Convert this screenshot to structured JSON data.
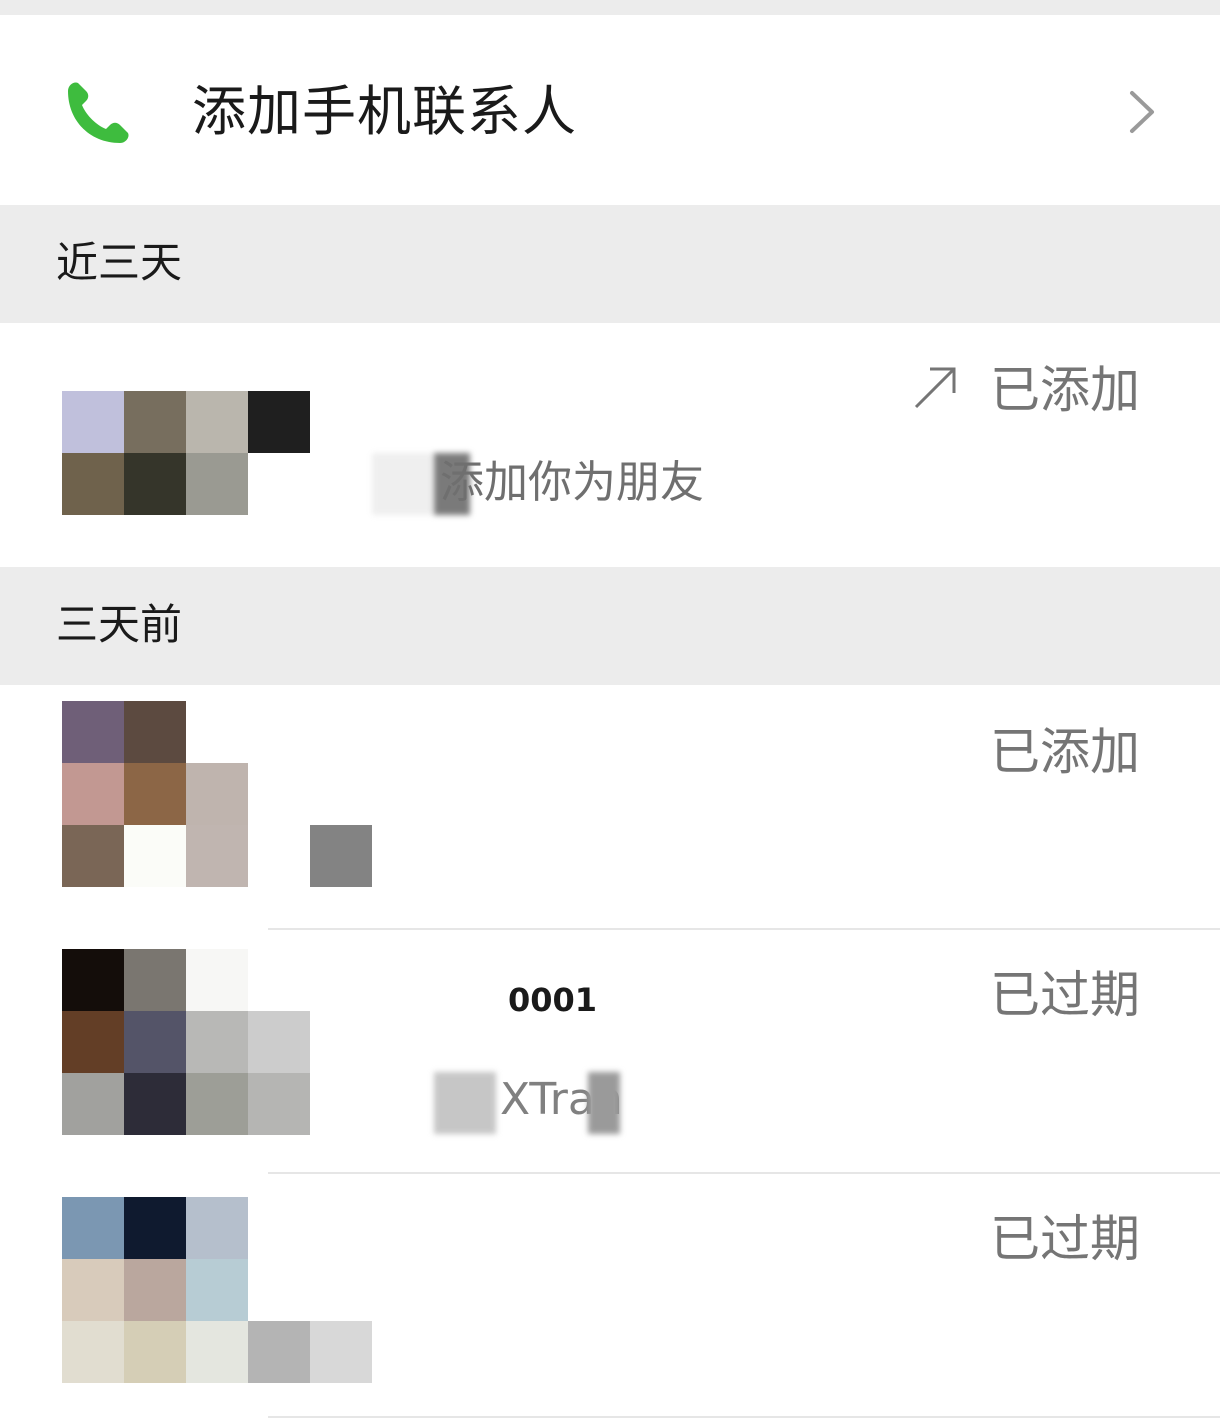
{
  "add_contacts": {
    "label": "添加手机联系人",
    "icon": "phone-icon",
    "accent": "#3ebc3e"
  },
  "sections": [
    {
      "label": "近三天"
    },
    {
      "label": "三天前"
    }
  ],
  "rows": [
    {
      "status": "已添加",
      "status_icon": "arrow-up-right-icon",
      "message": "添加你为朋友",
      "avatar_cells": [
        "#c0c0dc",
        "#776e5e",
        "#bab6ad",
        "#1f1f1f",
        "",
        "#6f624c",
        "#35352a",
        "#9a9a92",
        "",
        ""
      ]
    },
    {
      "status": "已添加",
      "avatar_cells": [
        "#6f5f78",
        "#5c4a40",
        "",
        "",
        "",
        "#c29892",
        "#8c6646",
        "#bfb4ae",
        "",
        "",
        "#7a6656",
        "#fbfcf8",
        "#c0b5b0",
        "",
        "#838383"
      ]
    },
    {
      "status": "已过期",
      "name": "0001",
      "message": "XTran",
      "avatar_cells": [
        "#140d0a",
        "#7a7670",
        "#f7f7f5",
        "",
        "",
        "#633e26",
        "#545468",
        "#b8b8b6",
        "#cccccc",
        "",
        "#a1a19e",
        "#2d2c38",
        "#9d9e97",
        "#b5b5b3",
        ""
      ]
    },
    {
      "status": "已过期",
      "avatar_cells": [
        "#7b97b2",
        "#0f1a2f",
        "#b5bfcc",
        "",
        "",
        "#d8cbbb",
        "#baa79e",
        "#b7ccd4",
        "",
        "",
        "#e1ddd0",
        "#d5ceb6",
        "#e4e6df",
        "#b4b4b4",
        "#d8d8d8"
      ]
    }
  ]
}
